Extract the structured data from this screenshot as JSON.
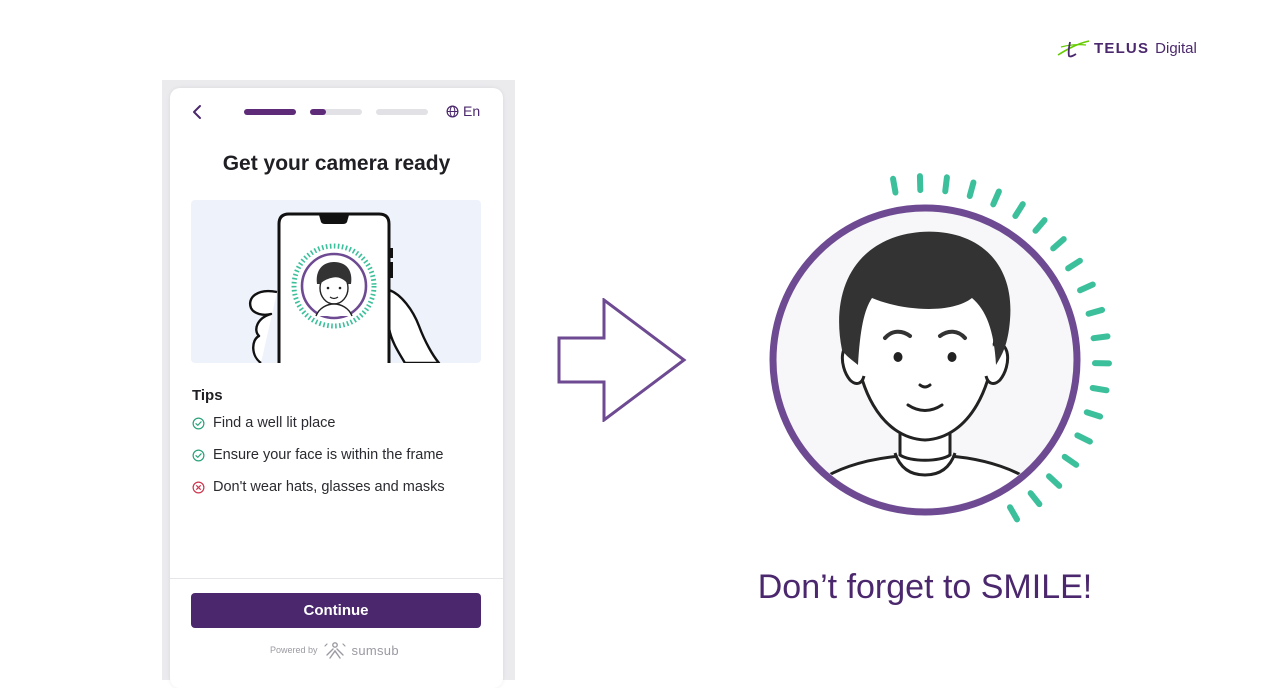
{
  "brand": {
    "name": "TELUS",
    "sub": "Digital",
    "accent_color": "#4b286d",
    "mark_color": "#66cc00",
    "icon": "telus-logo-icon"
  },
  "phone": {
    "back_icon": "chevron-left-icon",
    "progress": [
      {
        "step": 1,
        "fill_fraction": 1.0
      },
      {
        "step": 2,
        "fill_fraction": 0.3
      },
      {
        "step": 3,
        "fill_fraction": 0.0
      }
    ],
    "language": {
      "icon": "globe-icon",
      "label": "En"
    },
    "title": "Get your camera ready",
    "illustration": "hands-holding-phone-face-scan",
    "tips_title": "Tips",
    "tips": [
      {
        "text": "Find a well lit place",
        "status": "do",
        "icon": "check-circle-icon",
        "color": "#2ba37a"
      },
      {
        "text": "Ensure your face is within the frame",
        "status": "do",
        "icon": "check-circle-icon",
        "color": "#2ba37a"
      },
      {
        "text": "Don't wear hats, glasses and masks",
        "status": "dont",
        "icon": "x-circle-icon",
        "color": "#d0364f"
      }
    ],
    "continue_label": "Continue",
    "powered_by": {
      "label": "Powered by",
      "name": "sumsub",
      "icon": "sumsub-logo-icon"
    }
  },
  "right": {
    "arrow_icon": "arrow-right-icon",
    "face_illustration": "smiling-face-scan",
    "ring_color": "#6e4a92",
    "tick_color": "#3cc09c",
    "caption": "Don’t forget to SMILE!"
  }
}
